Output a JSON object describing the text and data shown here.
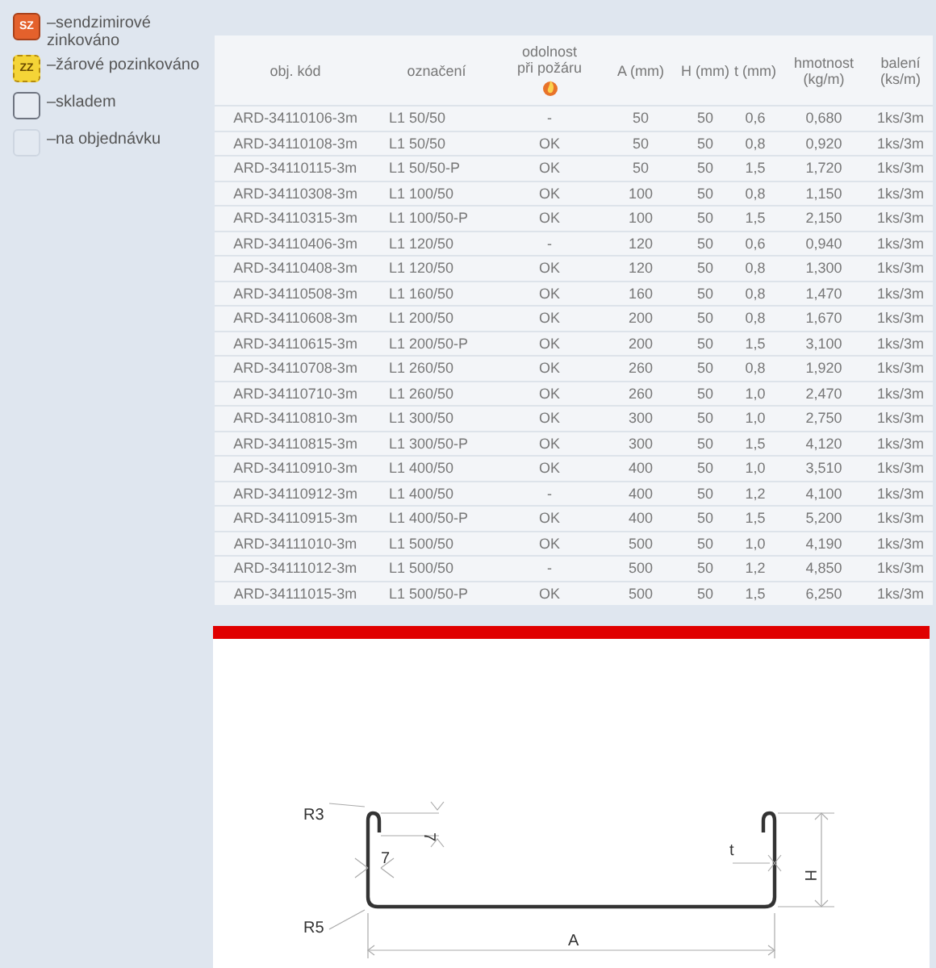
{
  "legend": [
    {
      "kind": "sz",
      "badge": "SZ",
      "label": "–sendzimirové zinkováno"
    },
    {
      "kind": "zz",
      "badge": "ZZ",
      "label": "–žárové pozinkováno"
    },
    {
      "kind": "stock",
      "label": "–skladem"
    },
    {
      "kind": "order",
      "label": "–na objednávku"
    }
  ],
  "table": {
    "columns": [
      {
        "label": "obj. kód"
      },
      {
        "label": "označení"
      },
      {
        "label": "odolnost při požáru",
        "kind": "fire_rating"
      },
      {
        "label": "A (mm)"
      },
      {
        "label": "H (mm)"
      },
      {
        "label": "t (mm)"
      },
      {
        "label": "hmotnost (kg/m)"
      },
      {
        "label": "balení (ks/m)"
      }
    ],
    "rows": [
      [
        "ARD-34110106-3m",
        "L1 50/50",
        "-",
        "50",
        "50",
        "0,6",
        "0,680",
        "1ks/3m"
      ],
      [
        "ARD-34110108-3m",
        "L1 50/50",
        "OK",
        "50",
        "50",
        "0,8",
        "0,920",
        "1ks/3m"
      ],
      [
        "ARD-34110115-3m",
        "L1 50/50-P",
        "OK",
        "50",
        "50",
        "1,5",
        "1,720",
        "1ks/3m"
      ],
      [
        "ARD-34110308-3m",
        "L1 100/50",
        "OK",
        "100",
        "50",
        "0,8",
        "1,150",
        "1ks/3m"
      ],
      [
        "ARD-34110315-3m",
        "L1 100/50-P",
        "OK",
        "100",
        "50",
        "1,5",
        "2,150",
        "1ks/3m"
      ],
      [
        "ARD-34110406-3m",
        "L1 120/50",
        "-",
        "120",
        "50",
        "0,6",
        "0,940",
        "1ks/3m"
      ],
      [
        "ARD-34110408-3m",
        "L1 120/50",
        "OK",
        "120",
        "50",
        "0,8",
        "1,300",
        "1ks/3m"
      ],
      [
        "ARD-34110508-3m",
        "L1 160/50",
        "OK",
        "160",
        "50",
        "0,8",
        "1,470",
        "1ks/3m"
      ],
      [
        "ARD-34110608-3m",
        "L1 200/50",
        "OK",
        "200",
        "50",
        "0,8",
        "1,670",
        "1ks/3m"
      ],
      [
        "ARD-34110615-3m",
        "L1 200/50-P",
        "OK",
        "200",
        "50",
        "1,5",
        "3,100",
        "1ks/3m"
      ],
      [
        "ARD-34110708-3m",
        "L1 260/50",
        "OK",
        "260",
        "50",
        "0,8",
        "1,920",
        "1ks/3m"
      ],
      [
        "ARD-34110710-3m",
        "L1 260/50",
        "OK",
        "260",
        "50",
        "1,0",
        "2,470",
        "1ks/3m"
      ],
      [
        "ARD-34110810-3m",
        "L1 300/50",
        "OK",
        "300",
        "50",
        "1,0",
        "2,750",
        "1ks/3m"
      ],
      [
        "ARD-34110815-3m",
        "L1 300/50-P",
        "OK",
        "300",
        "50",
        "1,5",
        "4,120",
        "1ks/3m"
      ],
      [
        "ARD-34110910-3m",
        "L1 400/50",
        "OK",
        "400",
        "50",
        "1,0",
        "3,510",
        "1ks/3m"
      ],
      [
        "ARD-34110912-3m",
        "L1 400/50",
        "-",
        "400",
        "50",
        "1,2",
        "4,100",
        "1ks/3m"
      ],
      [
        "ARD-34110915-3m",
        "L1 400/50-P",
        "OK",
        "400",
        "50",
        "1,5",
        "5,200",
        "1ks/3m"
      ],
      [
        "ARD-34111010-3m",
        "L1 500/50",
        "OK",
        "500",
        "50",
        "1,0",
        "4,190",
        "1ks/3m"
      ],
      [
        "ARD-34111012-3m",
        "L1 500/50",
        "-",
        "500",
        "50",
        "1,2",
        "4,850",
        "1ks/3m"
      ],
      [
        "ARD-34111015-3m",
        "L1 500/50-P",
        "OK",
        "500",
        "50",
        "1,5",
        "6,250",
        "1ks/3m"
      ]
    ]
  },
  "drawing": {
    "labels": [
      "R3",
      "7",
      "7",
      "t",
      "H",
      "R5",
      "A"
    ]
  }
}
